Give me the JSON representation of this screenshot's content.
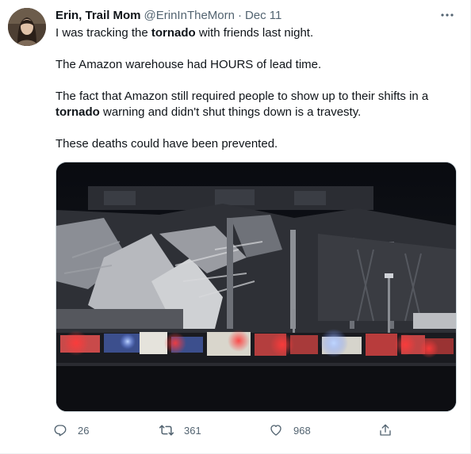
{
  "tweet": {
    "author": {
      "name": "Erin, Trail Mom",
      "handle": "@ErinInTheMorn",
      "separator": "·",
      "date": "Dec 11"
    },
    "text": {
      "p1_pre": "I was tracking the ",
      "p1_bold": "tornado",
      "p1_post": " with friends last night.",
      "p2": "The Amazon warehouse had HOURS of lead time.",
      "p3_pre": "The fact that Amazon still required people to show up to their shifts in a ",
      "p3_bold": "tornado",
      "p3_post": " warning and didn't shut things down is a travesty.",
      "p4": "These deaths could have been prevented."
    },
    "media": {
      "kind": "photo"
    },
    "stats": {
      "replies": "26",
      "retweets": "361",
      "likes": "968"
    },
    "icons": {
      "more": "more-horizontal-icon",
      "reply": "reply-icon",
      "retweet": "retweet-icon",
      "like": "heart-icon",
      "share": "share-icon"
    },
    "colors": {
      "text_primary": "#0f1419",
      "text_secondary": "#536471",
      "border": "#cfd9de"
    }
  }
}
